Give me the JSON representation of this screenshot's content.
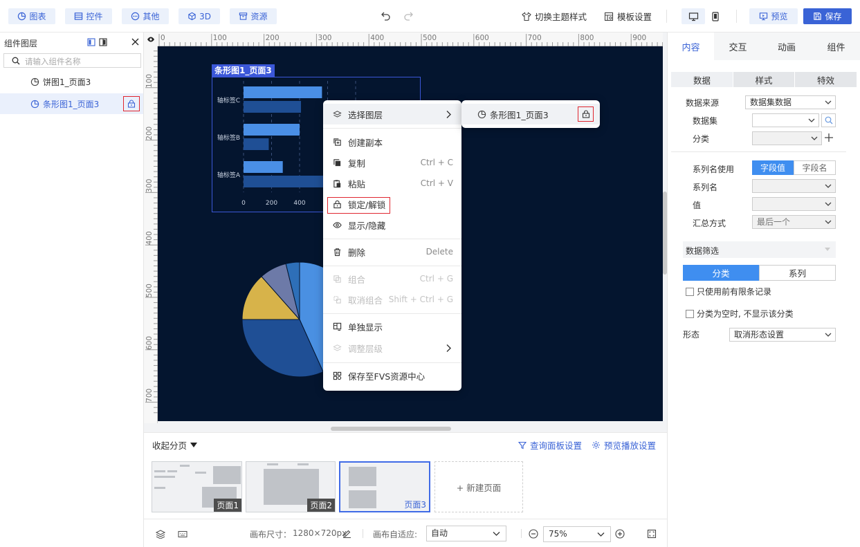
{
  "toolbar": {
    "buttons": [
      {
        "label": "图表",
        "icon": "chart-icon"
      },
      {
        "label": "控件",
        "icon": "widget-icon"
      },
      {
        "label": "其他",
        "icon": "other-icon"
      },
      {
        "label": "3D",
        "icon": "cube-icon"
      },
      {
        "label": "资源",
        "icon": "resource-icon"
      }
    ],
    "theme_label": "切换主题样式",
    "template_label": "模板设置",
    "preview_label": "预览",
    "save_label": "保存"
  },
  "left_panel": {
    "title": "组件图层",
    "search_placeholder": "请输入组件名称",
    "layers": [
      {
        "label": "饼图1_页面3",
        "selected": false
      },
      {
        "label": "条形图1_页面3",
        "selected": true
      }
    ]
  },
  "ruler": {
    "h_labels": [
      "0",
      "100",
      "200",
      "300",
      "400",
      "500",
      "600",
      "700",
      "800",
      "900"
    ],
    "v_labels": [
      "100",
      "200",
      "300",
      "400",
      "500",
      "600",
      "700"
    ]
  },
  "stage": {
    "bar_chart": {
      "tag": "条形图1_页面3",
      "categories": [
        "轴标签C",
        "轴标签B",
        "轴标签A"
      ],
      "x_ticks": [
        "0",
        "200",
        "400"
      ]
    }
  },
  "chart_data": [
    {
      "type": "bar",
      "orientation": "horizontal",
      "categories": [
        "轴标签C",
        "轴标签B",
        "轴标签A"
      ],
      "series": [
        {
          "values": [
            560,
            400,
            280
          ]
        },
        {
          "values": [
            410,
            180,
            600
          ]
        }
      ],
      "xlim": [
        0,
        800
      ],
      "x_ticks": [
        "0",
        "200",
        "400"
      ]
    },
    {
      "type": "pie",
      "values": [
        45,
        33,
        14,
        8,
        4
      ],
      "colors": [
        "#4a90e2",
        "#1f4f95",
        "#d7b34a",
        "#6d7aa8",
        "#2e6fb8"
      ]
    }
  ],
  "context_menu": {
    "items": [
      {
        "label": "选择图层",
        "icon": "layers-icon",
        "shortcut": "",
        "submenu": true,
        "disabled": false
      },
      {
        "label": "创建副本",
        "icon": "duplicate-icon",
        "shortcut": "",
        "disabled": false
      },
      {
        "label": "复制",
        "icon": "copy-icon",
        "shortcut": "Ctrl + C",
        "disabled": false
      },
      {
        "label": "粘贴",
        "icon": "paste-icon",
        "shortcut": "Ctrl + V",
        "disabled": false
      },
      {
        "label": "锁定/解锁",
        "icon": "lock-icon",
        "shortcut": "",
        "disabled": false
      },
      {
        "label": "显示/隐藏",
        "icon": "eye-icon",
        "shortcut": "",
        "disabled": false
      },
      {
        "label": "删除",
        "icon": "trash-icon",
        "shortcut": "Delete",
        "disabled": false
      },
      {
        "label": "组合",
        "icon": "group-icon",
        "shortcut": "Ctrl + G",
        "disabled": true
      },
      {
        "label": "取消组合",
        "icon": "ungroup-icon",
        "shortcut": "Shift + Ctrl + G",
        "disabled": true
      },
      {
        "label": "单独显示",
        "icon": "solo-icon",
        "shortcut": "",
        "disabled": false
      },
      {
        "label": "调整层级",
        "icon": "level-icon",
        "shortcut": "",
        "submenu": true,
        "disabled": true
      },
      {
        "label": "保存至FVS资源中心",
        "icon": "save-fvs-icon",
        "shortcut": "",
        "disabled": false
      }
    ],
    "submenu_item": "条形图1_页面3"
  },
  "pages_panel": {
    "collapse_label": "收起分页",
    "query_panel_label": "查询面板设置",
    "preview_play_label": "预览播放设置",
    "pages": [
      "页面1",
      "页面2",
      "页面3"
    ],
    "new_page_label": "+ 新建页面"
  },
  "status_bar": {
    "canvas_size_label": "画布尺寸：",
    "canvas_size_value": "1280×720px",
    "auto_fit_label": "画布自适应:",
    "auto_fit_value": "自动",
    "zoom_value": "75%"
  },
  "right_panel": {
    "tabs": [
      "内容",
      "交互",
      "动画",
      "组件"
    ],
    "subtabs": [
      "数据",
      "样式",
      "特效"
    ],
    "data_source_label": "数据来源",
    "data_source_value": "数据集数据",
    "dataset_label": "数据集",
    "category_label": "分类",
    "series_name_use_label": "系列名使用",
    "field_value_label": "字段值",
    "field_name_label": "字段名",
    "series_name_label": "系列名",
    "value_label": "值",
    "summary_label": "汇总方式",
    "summary_value": "最后一个",
    "data_filter_label": "数据筛选",
    "filter_tabs": [
      "分类",
      "系列"
    ],
    "limit_records_label": "只使用前有限条记录",
    "hide_empty_label": "分类为空时, 不显示该分类",
    "form_label": "形态",
    "form_value": "取消形态设置"
  },
  "colors": {
    "accent": "#3a63d6",
    "stage_bg": "#04152f",
    "highlight_red": "#e0262f"
  }
}
